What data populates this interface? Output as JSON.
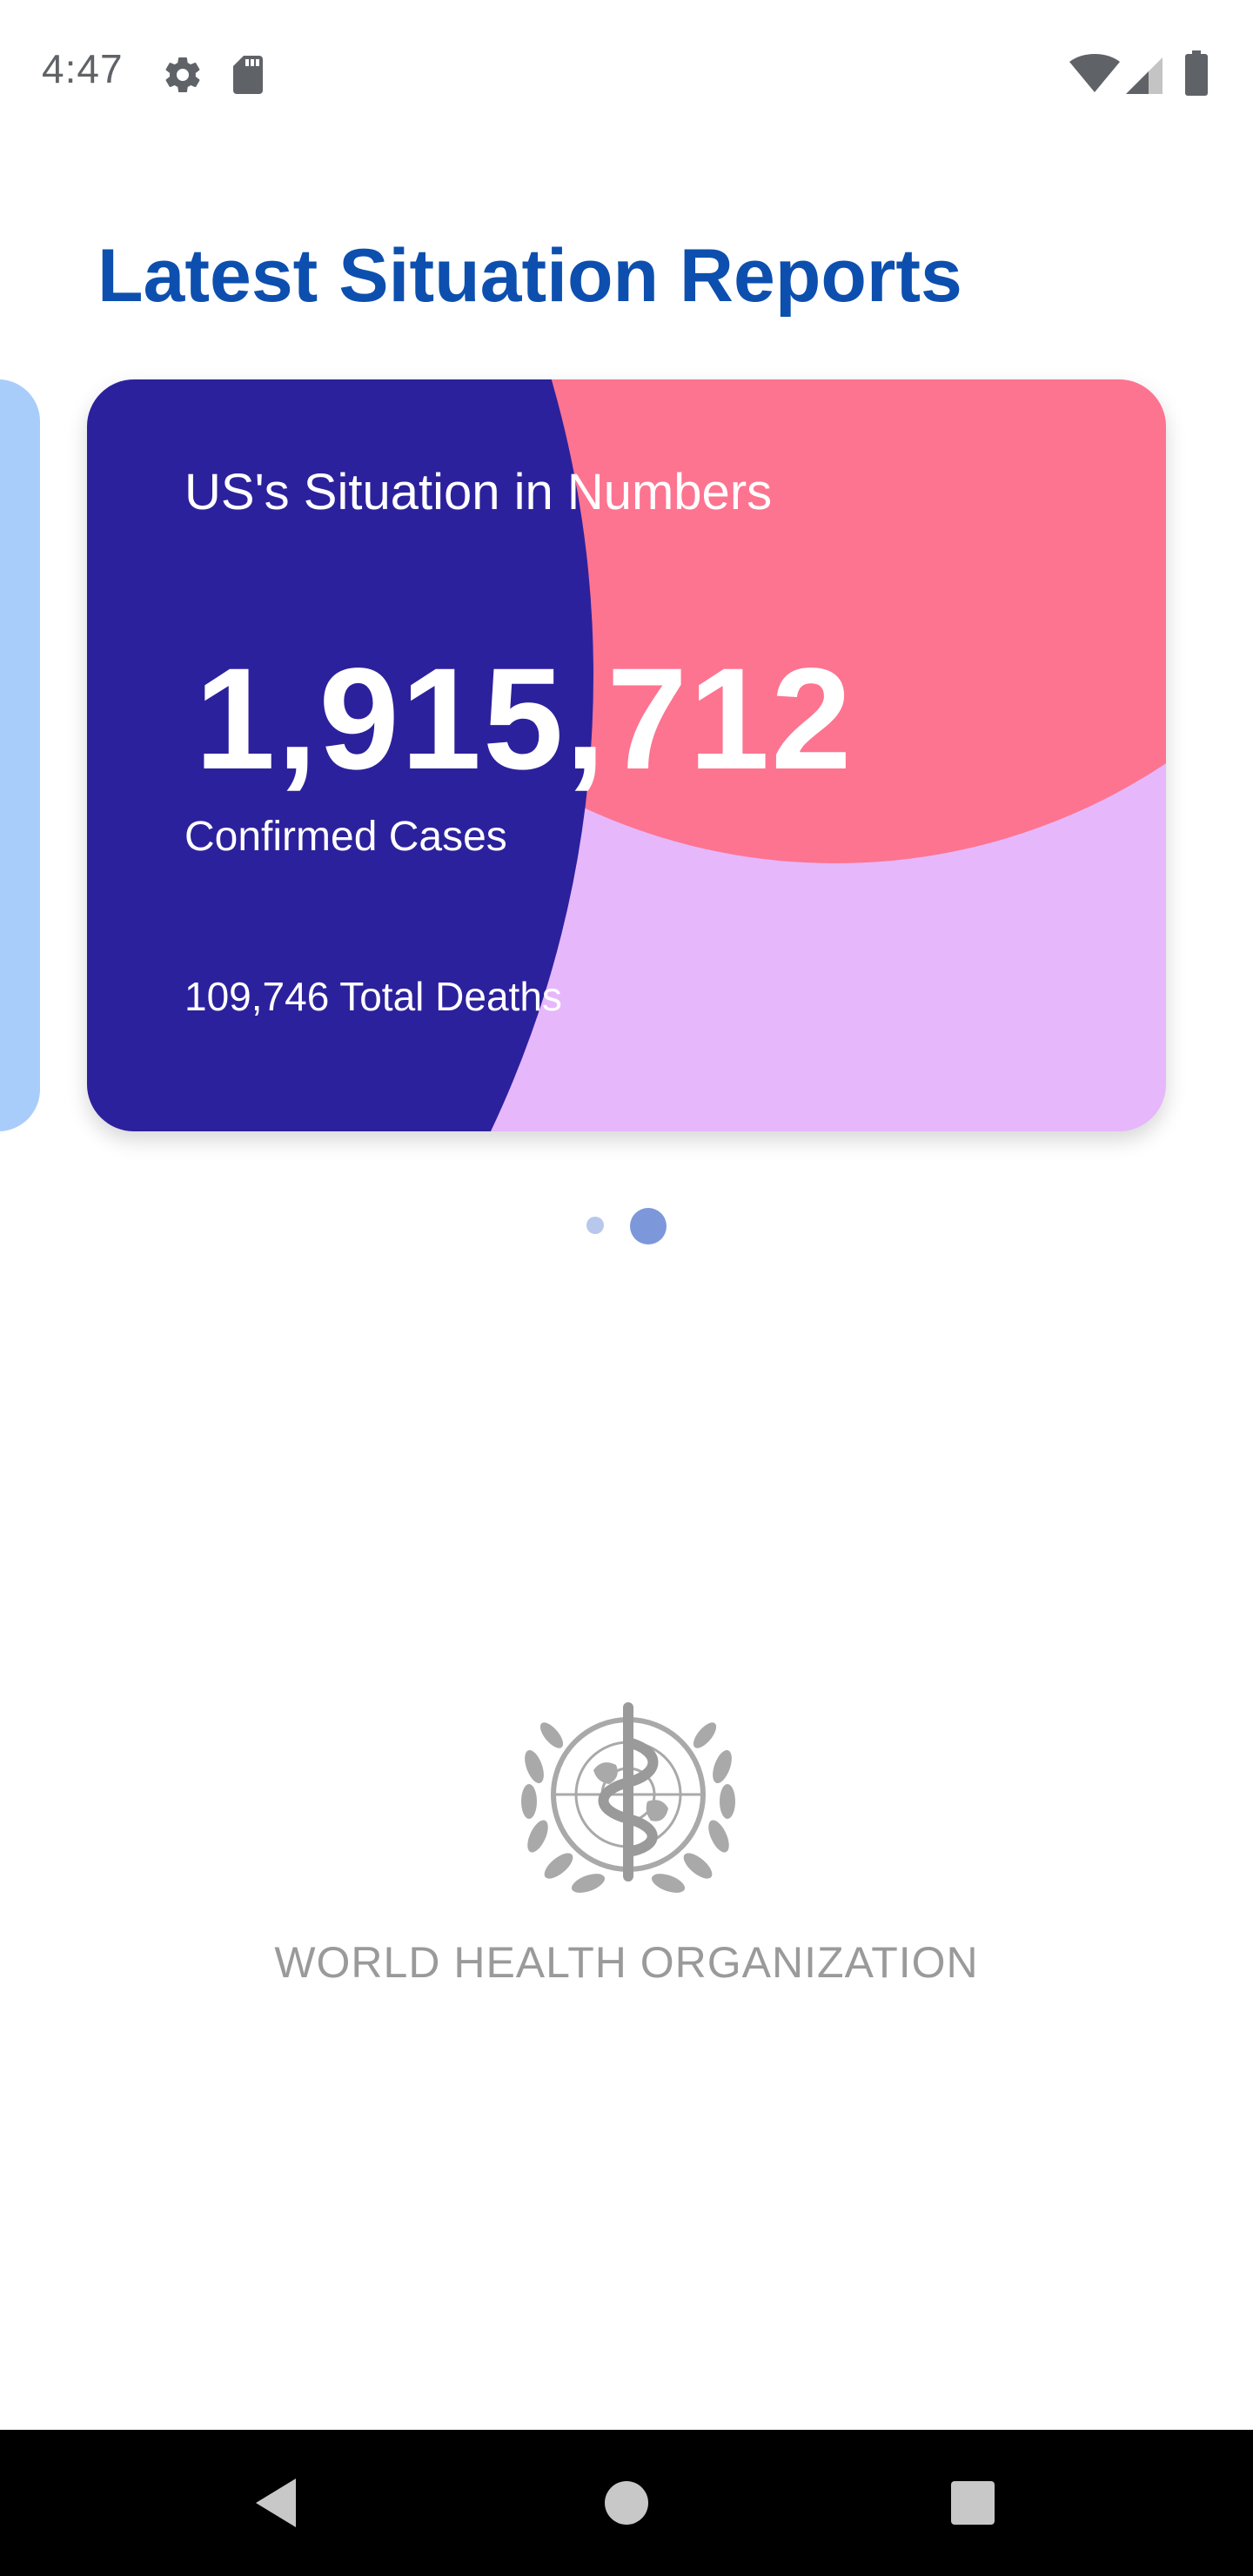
{
  "status_bar": {
    "time": "4:47",
    "left_icons": [
      "gear-icon",
      "sd-card-icon"
    ],
    "right_icons": [
      "wifi-icon",
      "cellular-signal-icon",
      "battery-icon"
    ]
  },
  "page": {
    "title": "Latest Situation Reports"
  },
  "carousel": {
    "total_pages": 2,
    "active_index": 1,
    "card": {
      "heading": "US's Situation in Numbers",
      "confirmed_count": "1,915,712",
      "confirmed_label": "Confirmed Cases",
      "deaths_text": "109,746 Total Deaths",
      "colors": {
        "primary": "#2c219c",
        "accent": "#fd7490",
        "background": "#e6b7fb"
      }
    },
    "previous_card_colors": {
      "background": "#a9cdfb",
      "accent": "#5ea2f1"
    }
  },
  "footer": {
    "org_name": "WORLD HEALTH ORGANIZATION",
    "emblem_icon": "who-emblem-icon"
  },
  "nav_bar": {
    "buttons": [
      "back-icon",
      "home-icon",
      "recents-icon"
    ]
  }
}
